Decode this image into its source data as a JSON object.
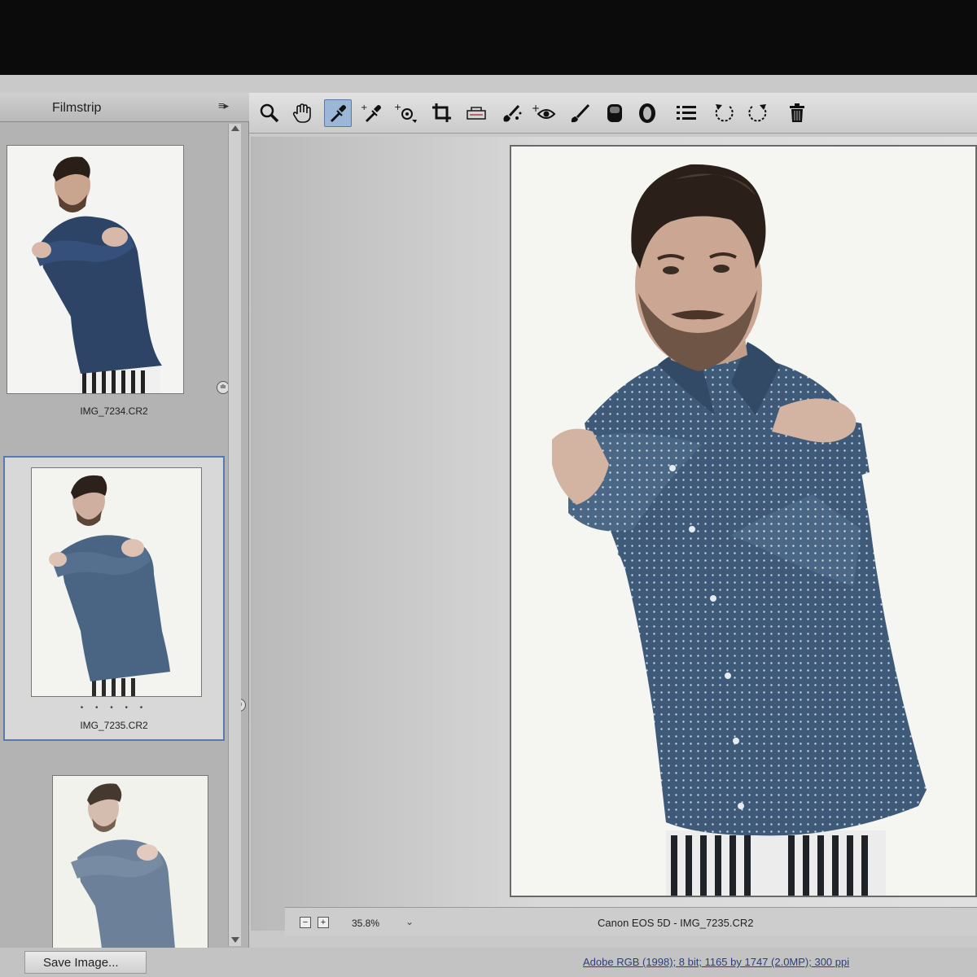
{
  "filmstrip": {
    "title": "Filmstrip",
    "menu_icon": "menu-lines-icon",
    "items": [
      {
        "filename": "IMG_7234.CR2",
        "selected": false,
        "stars": ""
      },
      {
        "filename": "IMG_7235.CR2",
        "selected": true,
        "stars": "• • • • •"
      },
      {
        "filename": "",
        "selected": false,
        "stars": ""
      }
    ]
  },
  "toolbar": {
    "tools": [
      "zoom-icon",
      "hand-icon",
      "white-balance-icon",
      "color-sampler-icon",
      "targeted-adjustment-icon",
      "crop-icon",
      "straighten-icon",
      "spot-removal-icon",
      "red-eye-icon",
      "adjustment-brush-icon",
      "graduated-filter-icon",
      "radial-filter-icon",
      "preferences-icon",
      "rotate-left-icon",
      "rotate-right-icon",
      "trash-icon"
    ],
    "active_tool": "white-balance-icon"
  },
  "preview": {
    "zoom_out_label": "−",
    "zoom_in_label": "+",
    "zoom_value": "35.8%",
    "title": "Canon EOS 5D  -  IMG_7235.CR2"
  },
  "bottom": {
    "save_label": "Save Image...",
    "workflow_options": "Adobe RGB (1998); 8 bit; 1165 by 1747 (2.0MP); 300 ppi"
  },
  "colors": {
    "shirt": "#3e5a78",
    "hair": "#2b1f19",
    "skin": "#c9a896",
    "selection": "#5a7aa8"
  }
}
